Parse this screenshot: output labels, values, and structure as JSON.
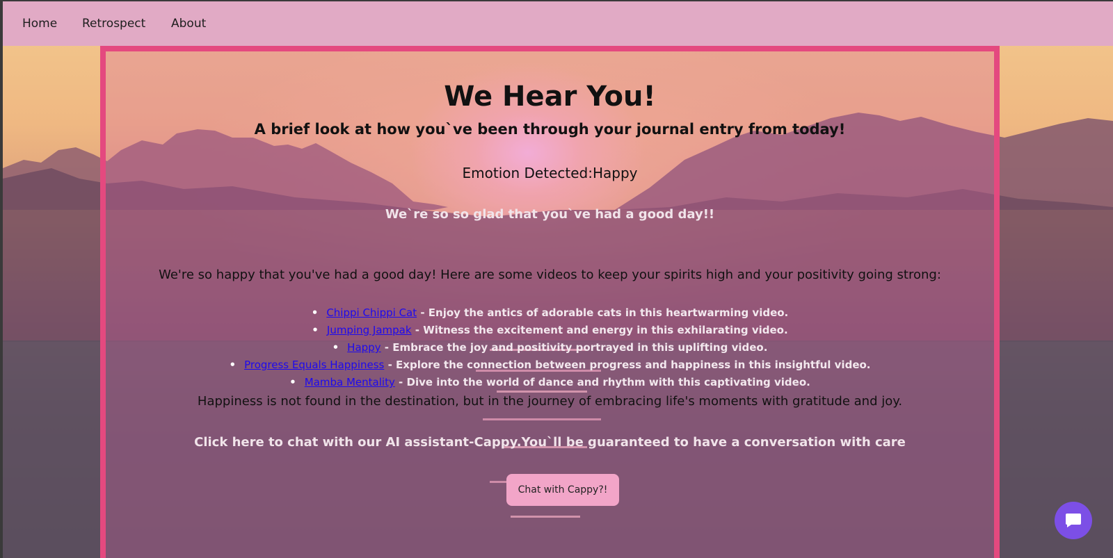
{
  "nav": {
    "items": [
      "Home",
      "Retrospect",
      "About"
    ]
  },
  "main": {
    "title": "We Hear You!",
    "subtitle": "A brief look at how you`ve been through your journal entry from today!",
    "emotion_label": "Emotion Detected:",
    "emotion_value": "Happy",
    "glad_message": "We`re so so glad that you`ve had a good day!!",
    "intro": "We're so happy that you've had a good day! Here are some videos to keep your spirits high and your positivity going strong:",
    "videos": [
      {
        "title": "Chippi Chippi Cat",
        "desc": " - Enjoy the antics of adorable cats in this heartwarming video."
      },
      {
        "title": "Jumping Jampak",
        "desc": " - Witness the excitement and energy in this exhilarating video."
      },
      {
        "title": "Happy",
        "desc": " - Embrace the joy and positivity portrayed in this uplifting video."
      },
      {
        "title": "Progress Equals Happiness",
        "desc": " - Explore the connection between progress and happiness in this insightful video."
      },
      {
        "title": "Mamba Mentality",
        "desc": " - Dive into the world of dance and rhythm with this captivating video."
      }
    ],
    "quote": "Happiness is not found in the destination, but in the journey of embracing life's moments with gratitude and joy.",
    "chat_prompt": "Click here to chat with our AI assistant-Cappy.You`ll be guaranteed to have a conversation with care",
    "chat_button": "Chat with Cappy?!"
  },
  "colors": {
    "navbar": "#e1aac5",
    "panel_border": "#e4497f",
    "link": "#1d0aee",
    "chat_button": "#f2a5c8",
    "fab": "#7c4fe6"
  },
  "icons": {
    "fab": "chat-bubble-icon"
  }
}
